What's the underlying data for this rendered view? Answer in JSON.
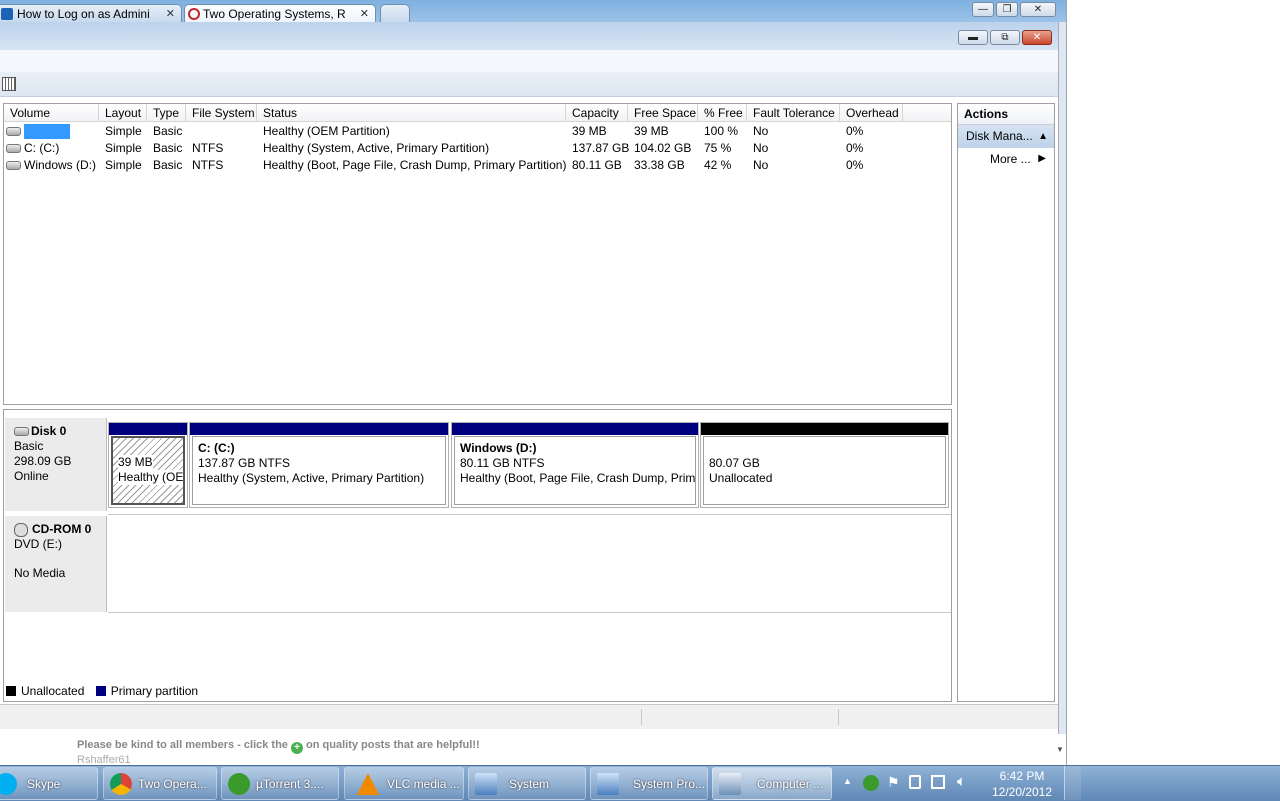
{
  "browser": {
    "tabs": [
      {
        "label": "How to Log on as Admini"
      },
      {
        "label": "Two Operating Systems, R"
      }
    ]
  },
  "table": {
    "columns": [
      "Volume",
      "Layout",
      "Type",
      "File System",
      "Status",
      "Capacity",
      "Free Space",
      "% Free",
      "Fault Tolerance",
      "Overhead"
    ],
    "rows": [
      {
        "volume": "",
        "layout": "Simple",
        "type": "Basic",
        "fs": "",
        "status": "Healthy (OEM Partition)",
        "capacity": "39 MB",
        "free": "39 MB",
        "pct": "100 %",
        "fault": "No",
        "overhead": "0%"
      },
      {
        "volume": "C: (C:)",
        "layout": "Simple",
        "type": "Basic",
        "fs": "NTFS",
        "status": "Healthy (System, Active, Primary Partition)",
        "capacity": "137.87 GB",
        "free": "104.02 GB",
        "pct": "75 %",
        "fault": "No",
        "overhead": "0%"
      },
      {
        "volume": "Windows (D:)",
        "layout": "Simple",
        "type": "Basic",
        "fs": "NTFS",
        "status": "Healthy (Boot, Page File, Crash Dump, Primary Partition)",
        "capacity": "80.11 GB",
        "free": "33.38 GB",
        "pct": "42 %",
        "fault": "No",
        "overhead": "0%"
      }
    ]
  },
  "disks": {
    "disk0": {
      "name": "Disk 0",
      "type": "Basic",
      "size": "298.09 GB",
      "state": "Online"
    },
    "cdrom0": {
      "name": "CD-ROM 0",
      "type": "DVD (E:)",
      "state": "No Media"
    },
    "partitions": [
      {
        "title": "",
        "line1": "39 MB",
        "line2": "Healthy (OEM"
      },
      {
        "title": "C:  (C:)",
        "line1": "137.87 GB NTFS",
        "line2": "Healthy (System, Active, Primary Partition)"
      },
      {
        "title": "Windows  (D:)",
        "line1": "80.11 GB NTFS",
        "line2": "Healthy (Boot, Page File, Crash Dump, Prima"
      },
      {
        "title": "",
        "line1": "80.07 GB",
        "line2": "Unallocated"
      }
    ]
  },
  "legend": {
    "unallocated": "Unallocated",
    "primary": "Primary partition",
    "unallocated_color": "#000000",
    "primary_color": "#00007f"
  },
  "actions": {
    "title": "Actions",
    "section": "Disk Mana...",
    "more": "More ..."
  },
  "forum": {
    "message_before": "Please be kind to all members - click the",
    "message_after": "on quality posts that are helpful!!",
    "signature": "Rshaffer61"
  },
  "taskbar": {
    "items": [
      {
        "label": "Skype"
      },
      {
        "label": "Two Opera..."
      },
      {
        "label": "µTorrent 3...."
      },
      {
        "label": "VLC media ..."
      },
      {
        "label": "System"
      },
      {
        "label": "System Pro..."
      },
      {
        "label": "Computer ..."
      }
    ],
    "time": "6:42 PM",
    "date": "12/20/2012"
  }
}
